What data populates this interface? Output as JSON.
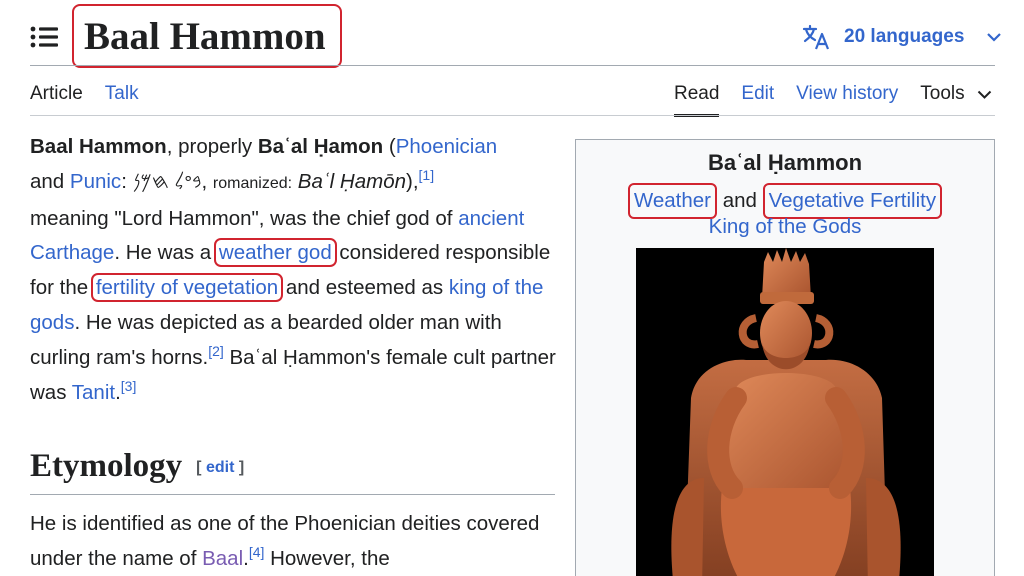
{
  "header": {
    "title": "Baal Hammon",
    "languages_label": "20 languages"
  },
  "tabs": {
    "article": "Article",
    "talk": "Talk",
    "read": "Read",
    "edit": "Edit",
    "view_history": "View history",
    "tools": "Tools"
  },
  "lead": {
    "name_bold": "Baal Hammon",
    "t1": ", properly ",
    "proper_bold": "Baʿal Ḥamon",
    "t2": " (",
    "phoenician_link": "Phoenician",
    "t3": "and ",
    "punic_link": "Punic",
    "t4": ": ",
    "script_text": "𐤁𐤏𐤋 𐤇𐤌𐤍",
    "romanized_label": "romanized:",
    "romanized_value": "Baʿl Ḥamōn",
    "t5": "),",
    "ref1": "[1]",
    "t6": "meaning \"Lord Hammon\", was the chief god of ",
    "ancient_carthage_link": "ancient Carthage",
    "t7": ". He was a ",
    "weather_god_link": "weather god",
    "t8": " considered responsible for the ",
    "fertility_link": "fertility of vegetation",
    "t9": " and esteemed as ",
    "king_link": "king of the gods",
    "t10": ". He was depicted as a bearded older man with curling ram's horns.",
    "ref2": "[2]",
    "t11": " Baʿal Ḥammon's female cult partner was ",
    "tanit_link": "Tanit",
    "t12": ".",
    "ref3": "[3]"
  },
  "etymology": {
    "heading": "Etymology",
    "edit_open": "[ ",
    "edit_label": "edit",
    "edit_close": " ]",
    "t1": "He is identified as one of the Phoenician deities covered under the name of ",
    "baal_link": "Baal",
    "t2": ".",
    "ref4": "[4]",
    "t3": " However, the"
  },
  "infobox": {
    "title": "Baʿal Ḥammon",
    "weather_link": "Weather",
    "and_text": "and",
    "veg_link": "Vegetative Fertility",
    "king_link": "King of the Gods"
  },
  "colors": {
    "link": "#3366cc",
    "visited_link": "#795cb2",
    "annotation_box": "#d1242f"
  }
}
